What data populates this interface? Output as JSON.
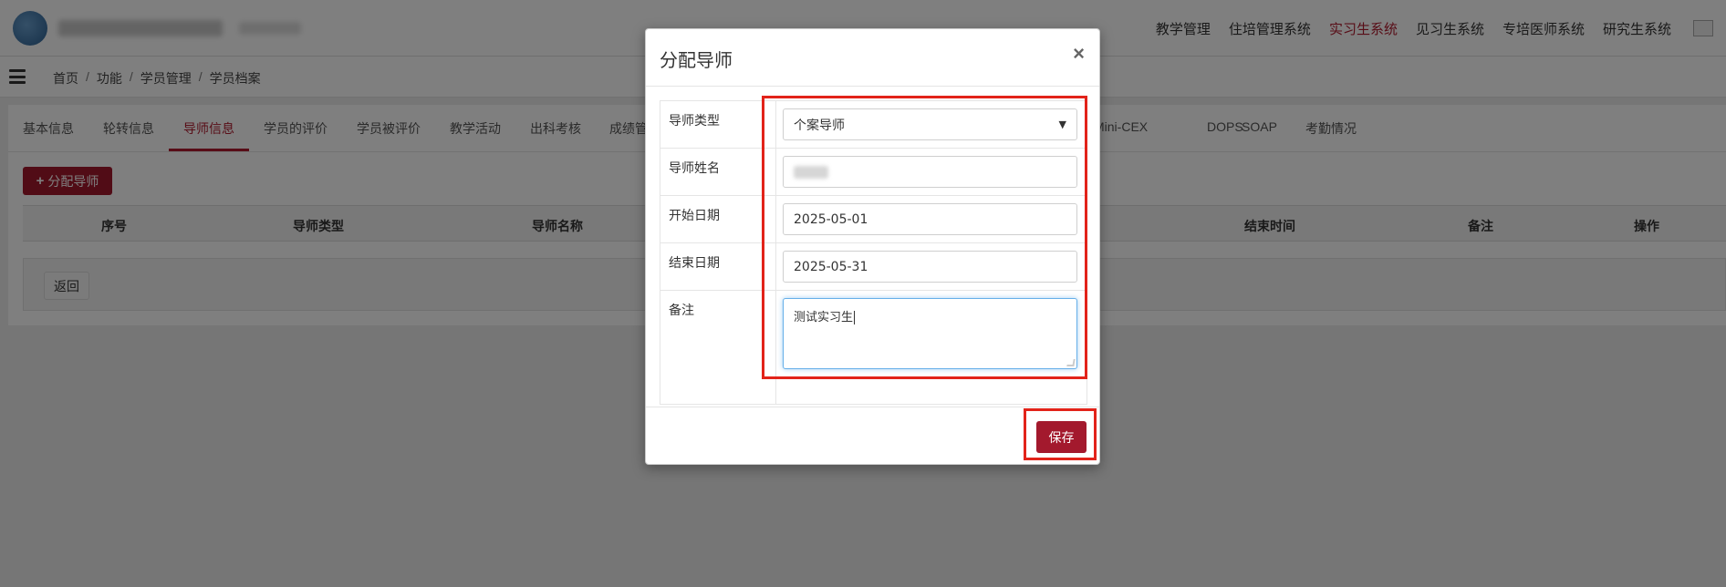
{
  "topbar": {
    "nav": [
      {
        "label": "教学管理",
        "active": false
      },
      {
        "label": "住培管理系统",
        "active": false
      },
      {
        "label": "实习生系统",
        "active": true
      },
      {
        "label": "见习生系统",
        "active": false
      },
      {
        "label": "专培医师系统",
        "active": false
      },
      {
        "label": "研究生系统",
        "active": false
      }
    ]
  },
  "breadcrumb": [
    "首页",
    "功能",
    "学员管理",
    "学员档案"
  ],
  "tabs": [
    {
      "label": "基本信息"
    },
    {
      "label": "轮转信息"
    },
    {
      "label": "导师信息",
      "active": true
    },
    {
      "label": "学员的评价"
    },
    {
      "label": "学员被评价"
    },
    {
      "label": "教学活动"
    },
    {
      "label": "出科考核"
    },
    {
      "label": "成绩管"
    },
    {
      "label": "Mini-CEX"
    },
    {
      "label": "DOPS"
    },
    {
      "label": "SOAP"
    },
    {
      "label": "考勤情况"
    }
  ],
  "toolbar": {
    "add_label": "分配导师"
  },
  "table": {
    "headers": [
      "序号",
      "导师类型",
      "导师名称",
      "结束时间",
      "备注",
      "操作"
    ]
  },
  "back_label": "返回",
  "modal": {
    "title": "分配导师",
    "close": "×",
    "fields": {
      "type_label": "导师类型",
      "type_value": "个案导师",
      "name_label": "导师姓名",
      "start_label": "开始日期",
      "start_value": "2025-05-01",
      "end_label": "结束日期",
      "end_value": "2025-05-31",
      "note_label": "备注",
      "note_value": "测试实习生"
    },
    "save_label": "保存"
  },
  "colors": {
    "accent": "#a3192d",
    "highlight": "#e2231a"
  }
}
